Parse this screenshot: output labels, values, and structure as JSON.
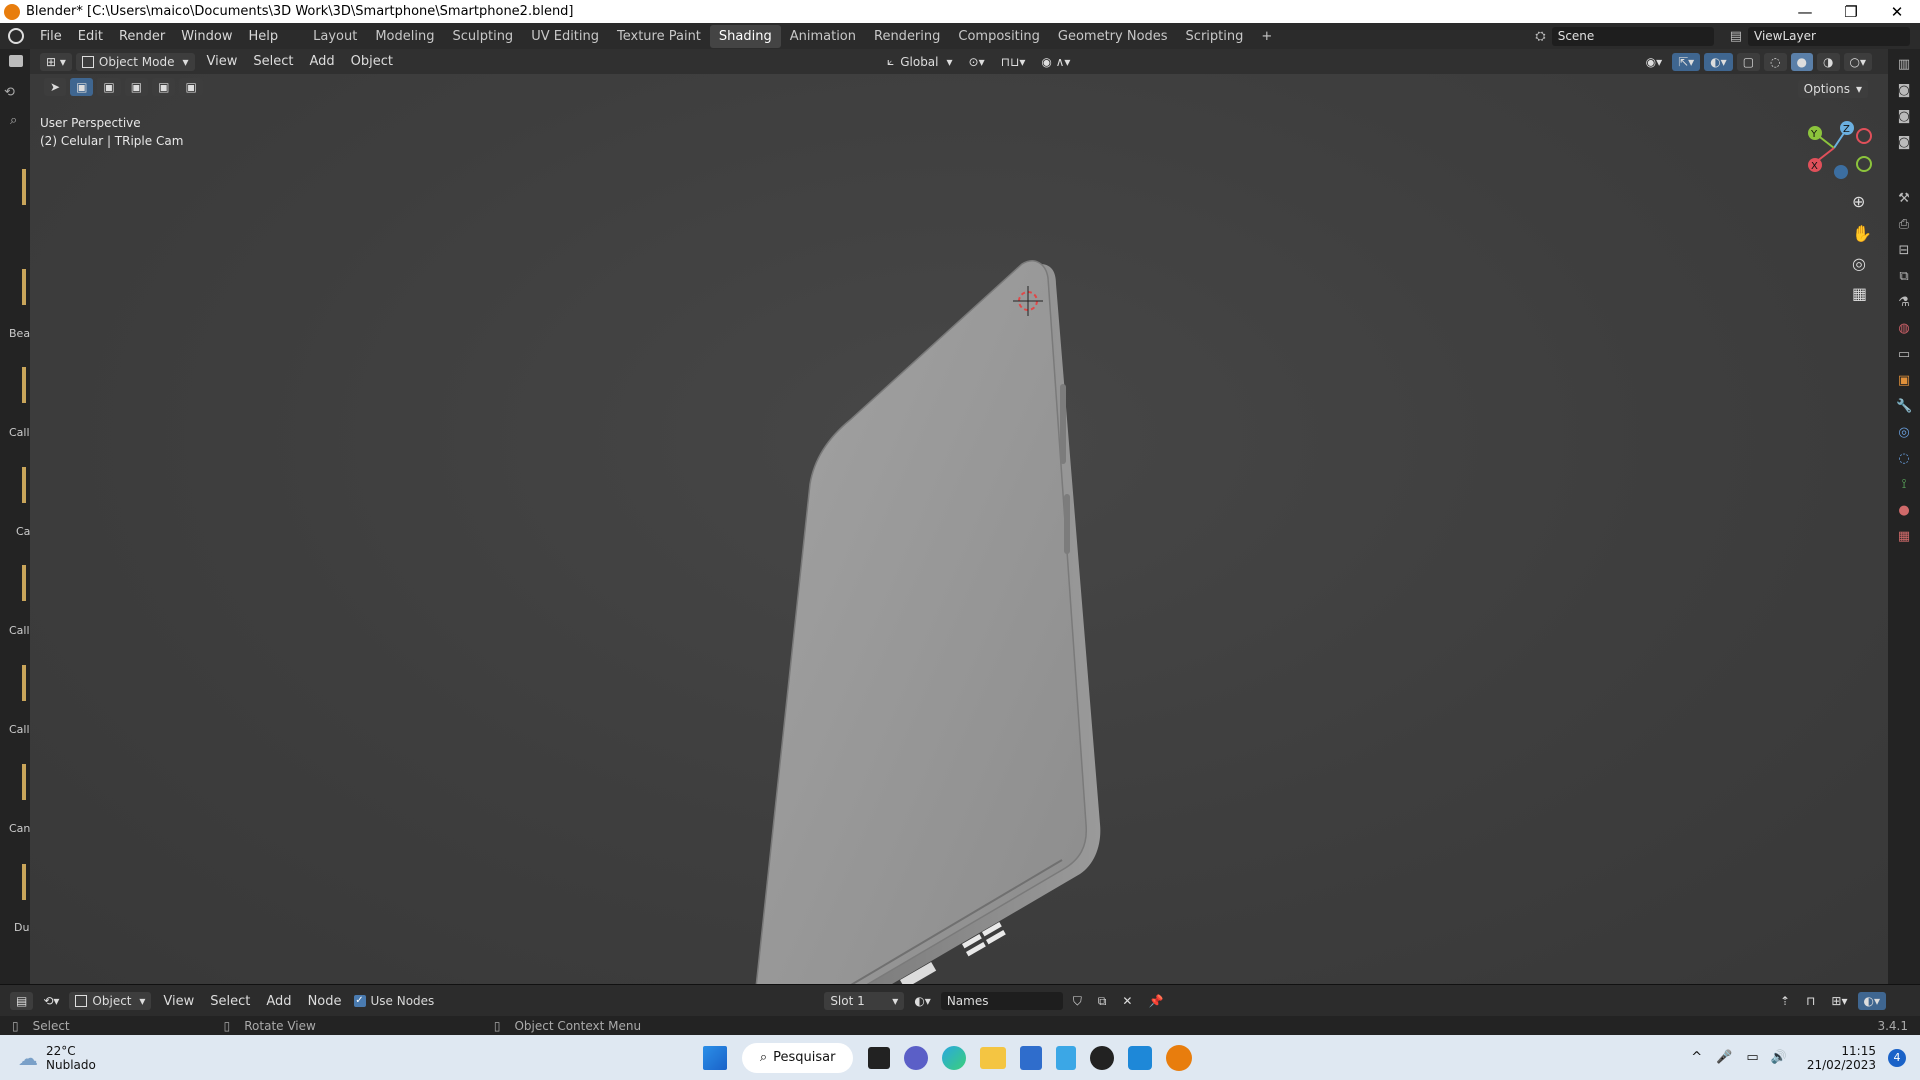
{
  "window": {
    "title": "Blender* [C:\\Users\\maico\\Documents\\3D Work\\3D\\Smartphone\\Smartphone2.blend]",
    "controls": [
      "—",
      "❐",
      "✕"
    ]
  },
  "menu": {
    "items": [
      "File",
      "Edit",
      "Render",
      "Window",
      "Help"
    ]
  },
  "workspaces": {
    "tabs": [
      "Layout",
      "Modeling",
      "Sculpting",
      "UV Editing",
      "Texture Paint",
      "Shading",
      "Animation",
      "Rendering",
      "Compositing",
      "Geometry Nodes",
      "Scripting"
    ],
    "active": "Shading",
    "add": "+"
  },
  "scene": {
    "label": "Scene",
    "view_layer": "ViewLayer"
  },
  "viewport_header": {
    "mode": "Object Mode",
    "menus": [
      "View",
      "Select",
      "Add",
      "Object"
    ],
    "orientation": "Global",
    "options": "Options"
  },
  "viewport": {
    "perspective": "User Perspective",
    "object_info": "(2) Celular | TRiple Cam",
    "gizmo": {
      "x": "X",
      "y": "Y",
      "z": "Z"
    }
  },
  "outliner_strip": {
    "labels": [
      "Bea",
      "Call",
      "Ca",
      "Call",
      "Call",
      "Can",
      "Du"
    ]
  },
  "node_header": {
    "editor": "Object",
    "menus": [
      "View",
      "Select",
      "Add",
      "Node"
    ],
    "use_nodes_label": "Use Nodes",
    "use_nodes_checked": true,
    "slot": "Slot 1",
    "material_name": "Names"
  },
  "status_bar": {
    "select": "Select",
    "rotate": "Rotate View",
    "context": "Object Context Menu",
    "version": "3.4.1"
  },
  "taskbar": {
    "weather_temp": "22°C",
    "weather_desc": "Nublado",
    "search_label": "Pesquisar",
    "time": "11:15",
    "date": "21/02/2023",
    "notifications": "4"
  },
  "colors": {
    "accent": "#e87d0d",
    "viewport": "#3e3e3e",
    "panel": "#2b2b2b"
  }
}
